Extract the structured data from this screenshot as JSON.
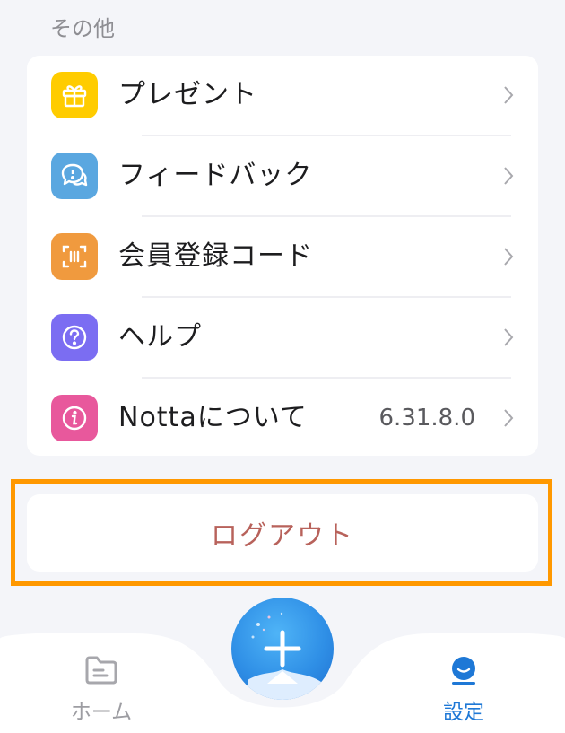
{
  "section": {
    "title": "その他"
  },
  "menu": {
    "items": [
      {
        "label": "プレゼント",
        "icon": "gift-icon",
        "color": "#ffcc00",
        "value": ""
      },
      {
        "label": "フィードバック",
        "icon": "chat-bubbles-icon",
        "color": "#5aa7e0",
        "value": ""
      },
      {
        "label": "会員登録コード",
        "icon": "scan-code-icon",
        "color": "#f09a3e",
        "value": ""
      },
      {
        "label": "ヘルプ",
        "icon": "question-icon",
        "color": "#7b6df2",
        "value": ""
      },
      {
        "label": "Nottaについて",
        "icon": "info-icon",
        "color": "#e8589c",
        "value": "6.31.8.0"
      }
    ]
  },
  "logout": {
    "label": "ログアウト",
    "color": "#b8625b"
  },
  "highlight": {
    "color": "#ff9800"
  },
  "tabbar": {
    "home": {
      "label": "ホーム",
      "icon": "folder-icon"
    },
    "add": {
      "icon": "plus-icon"
    },
    "settings": {
      "label": "設定",
      "icon": "profile-icon",
      "color": "#1e78d6"
    }
  }
}
